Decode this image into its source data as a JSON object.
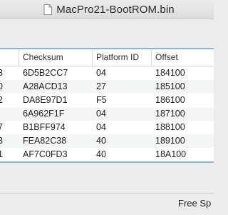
{
  "window": {
    "title": "MacPro21-BootROM.bin"
  },
  "table": {
    "headers": [
      "",
      "Checksum",
      "Platform ID",
      "Offset"
    ],
    "rows": [
      {
        "edge": "3",
        "checksum": "6D5B2CC7",
        "platform_id": "04",
        "offset": "184100"
      },
      {
        "edge": "0",
        "checksum": "A28ACD13",
        "platform_id": "27",
        "offset": "185100"
      },
      {
        "edge": "2",
        "checksum": "DA8E97D1",
        "platform_id": "F5",
        "offset": "186100"
      },
      {
        "edge": "",
        "checksum": "6A962F1F",
        "platform_id": "04",
        "offset": "187100"
      },
      {
        "edge": "7",
        "checksum": "B1BFF974",
        "platform_id": "04",
        "offset": "188100"
      },
      {
        "edge": "3",
        "checksum": "FEA82C38",
        "platform_id": "40",
        "offset": "189100"
      },
      {
        "edge": "1",
        "checksum": "AF7C0FD3",
        "platform_id": "40",
        "offset": "18A100"
      }
    ]
  },
  "statusbar": {
    "text": "Free Sp"
  }
}
